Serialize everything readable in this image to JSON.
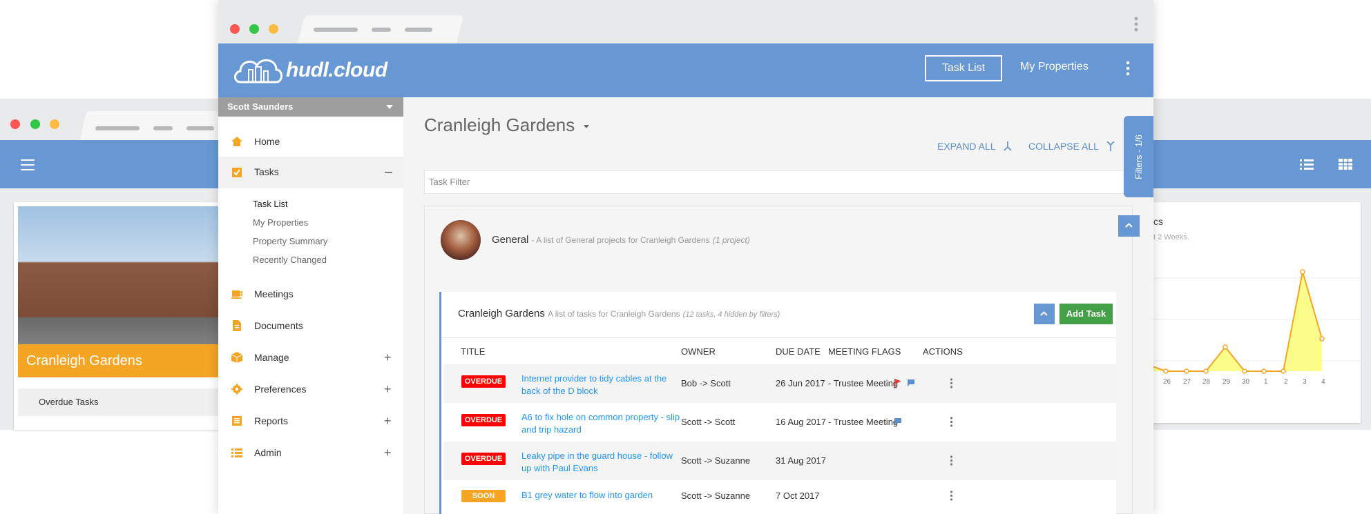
{
  "colors": {
    "primary": "#6898d4",
    "accent_orange": "#f5a524",
    "overdue_red": "#ff0000",
    "add_green": "#43a047",
    "link_blue": "#2196f3"
  },
  "background_window": {
    "card_title": "Cranleigh Gardens",
    "overdue_label": "Overdue Tasks",
    "chart_title_fragment": "cs",
    "chart_subtitle_fragment": "t 2 Weeks.",
    "chart_x_labels": [
      "26",
      "27",
      "28",
      "29",
      "30",
      "1",
      "2",
      "3",
      "4"
    ]
  },
  "appbar": {
    "logo": "hudl.cloud",
    "nav_task_list": "Task List",
    "nav_my_properties": "My Properties"
  },
  "sidebar": {
    "user": "Scott Saunders",
    "items": [
      {
        "label": "Home",
        "icon": "home-icon"
      },
      {
        "label": "Tasks",
        "icon": "clipboard-check-icon",
        "expanded": true
      },
      {
        "label": "Meetings",
        "icon": "coffee-icon"
      },
      {
        "label": "Documents",
        "icon": "document-icon"
      },
      {
        "label": "Manage",
        "icon": "box-icon"
      },
      {
        "label": "Preferences",
        "icon": "gear-icon"
      },
      {
        "label": "Reports",
        "icon": "report-icon"
      },
      {
        "label": "Admin",
        "icon": "list-icon"
      }
    ],
    "task_subitems": [
      "Task List",
      "My Properties",
      "Property Summary",
      "Recently Changed"
    ]
  },
  "main": {
    "title": "Cranleigh Gardens",
    "expand_all": "EXPAND ALL",
    "collapse_all": "COLLAPSE ALL",
    "filter_placeholder": "Task Filter",
    "filters_tab": "Filters - 1/6",
    "general": {
      "name": "General",
      "description": "- A list of General projects for Cranleigh Gardens",
      "count": "(1 project)"
    },
    "task_group": {
      "name": "Cranleigh Gardens",
      "description": "A list of tasks for Cranleigh Gardens",
      "count": "(12 tasks, 4 hidden by filters)",
      "add_task": "Add Task",
      "columns": [
        "TITLE",
        "OWNER",
        "DUE DATE",
        "MEETING FLAGS",
        "ACTIONS"
      ],
      "rows": [
        {
          "status": "OVERDUE",
          "title": "Internet provider to tidy cables at the back of the D block",
          "owner": "Bob -> Scott",
          "due": "26 Jun 2017",
          "meeting": "- Trustee Meeting",
          "flags": [
            "flag-icon",
            "comment-icon"
          ]
        },
        {
          "status": "OVERDUE",
          "title": "A6 to fix hole on common property - slip and trip hazard",
          "owner": "Scott -> Scott",
          "due": "16 Aug 2017",
          "meeting": "- Trustee Meeting",
          "flags": [
            "comment-icon"
          ]
        },
        {
          "status": "OVERDUE",
          "title": "Leaky pipe in the guard house - follow up with Paul Evans",
          "owner": "Scott -> Suzanne",
          "due": "31 Aug 2017",
          "meeting": "",
          "flags": []
        },
        {
          "status": "SOON",
          "title": "B1 grey water to flow into garden",
          "owner": "Scott -> Suzanne",
          "due": "7 Oct 2017",
          "meeting": "",
          "flags": []
        }
      ]
    }
  }
}
